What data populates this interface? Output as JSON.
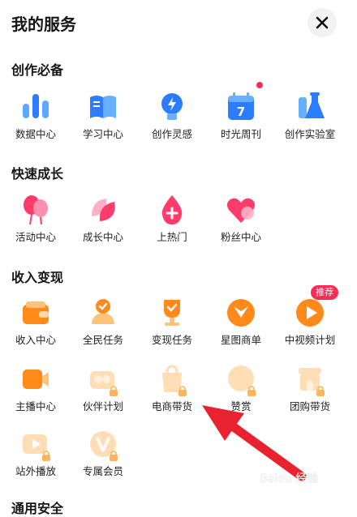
{
  "header": {
    "title": "我的服务",
    "close_icon": "close-icon"
  },
  "sections": [
    {
      "title": "创作必备",
      "items": [
        {
          "label": "数据中心",
          "icon": "chart-bars-icon",
          "badge_dot": false,
          "badge": ""
        },
        {
          "label": "学习中心",
          "icon": "book-icon",
          "badge_dot": false,
          "badge": ""
        },
        {
          "label": "创作灵感",
          "icon": "bulb-icon",
          "badge_dot": false,
          "badge": ""
        },
        {
          "label": "时光周刊",
          "icon": "calendar-icon",
          "badge_dot": true,
          "badge": "7"
        },
        {
          "label": "创作实验室",
          "icon": "flask-icon",
          "badge_dot": false,
          "badge": ""
        }
      ]
    },
    {
      "title": "快速成长",
      "items": [
        {
          "label": "活动中心",
          "icon": "balloon-icon"
        },
        {
          "label": "成长中心",
          "icon": "leaf-icon"
        },
        {
          "label": "上热门",
          "icon": "fire-drop-icon"
        },
        {
          "label": "粉丝中心",
          "icon": "heart-icon"
        }
      ]
    },
    {
      "title": "收入变现",
      "items": [
        {
          "label": "收入中心",
          "icon": "wallet-icon",
          "badge": ""
        },
        {
          "label": "全民任务",
          "icon": "person-icon",
          "badge": ""
        },
        {
          "label": "变现任务",
          "icon": "trophy-icon",
          "badge": ""
        },
        {
          "label": "星图商单",
          "icon": "star-map-icon",
          "badge": ""
        },
        {
          "label": "中视频计划",
          "icon": "play-icon",
          "badge": "推荐"
        },
        {
          "label": "主播中心",
          "icon": "camera-icon",
          "badge": ""
        },
        {
          "label": "伙伴计划",
          "icon": "partner-icon",
          "badge": ""
        },
        {
          "label": "电商带货",
          "icon": "shopping-bag-icon",
          "badge": ""
        },
        {
          "label": "赞赏",
          "icon": "reward-icon",
          "badge": ""
        },
        {
          "label": "团购带货",
          "icon": "store-icon",
          "badge": ""
        },
        {
          "label": "站外播放",
          "icon": "external-play-icon",
          "badge": ""
        },
        {
          "label": "专属会员",
          "icon": "vip-icon",
          "badge": ""
        }
      ]
    },
    {
      "title": "通用安全"
    }
  ],
  "watermark": "Baidu 经验",
  "colors": {
    "accent": "#fe2c55",
    "arrow": "#e8232f",
    "blue": "#2b7cff",
    "pink": "#ff5f8a",
    "orange": "#ff8a1a"
  }
}
